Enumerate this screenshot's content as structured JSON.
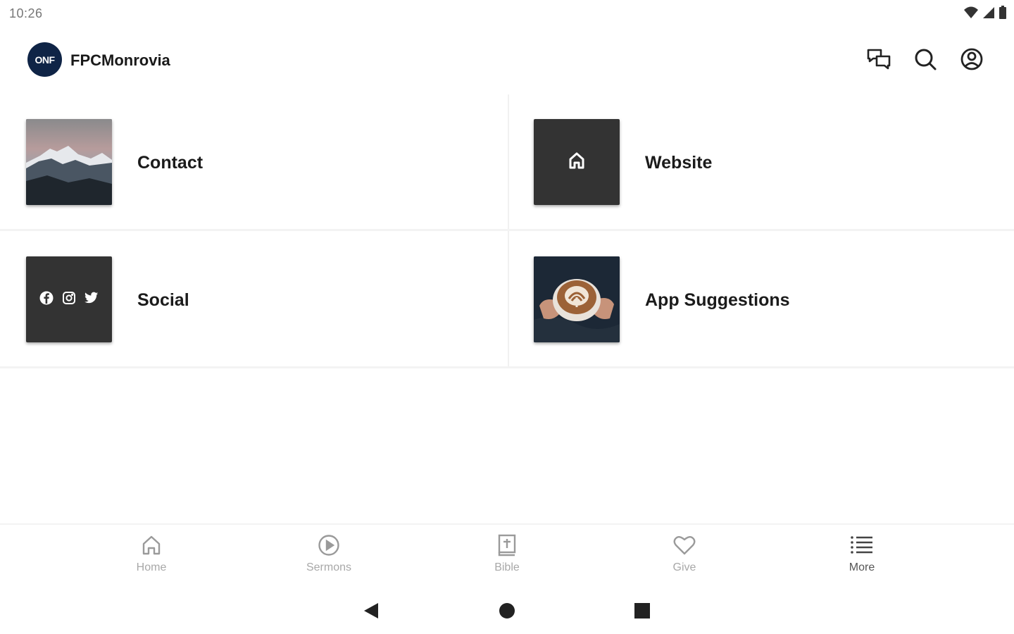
{
  "status_bar": {
    "time": "10:26",
    "icons": [
      "wifi-icon",
      "signal-icon",
      "battery-icon"
    ]
  },
  "app_bar": {
    "logo_text": "ONF",
    "title": "FPCMonrovia",
    "actions": [
      "chat-icon",
      "search-icon",
      "account-icon"
    ]
  },
  "tiles": [
    {
      "label": "Contact",
      "thumb": "mountain-photo"
    },
    {
      "label": "Website",
      "thumb": "home-icon"
    },
    {
      "label": "Social",
      "thumb": "social-icons"
    },
    {
      "label": "App Suggestions",
      "thumb": "coffee-photo"
    }
  ],
  "bottom_nav": [
    {
      "label": "Home",
      "icon": "home-icon"
    },
    {
      "label": "Sermons",
      "icon": "play-circle-icon"
    },
    {
      "label": "Bible",
      "icon": "bible-icon"
    },
    {
      "label": "Give",
      "icon": "heart-icon"
    },
    {
      "label": "More",
      "icon": "list-icon",
      "active": true
    }
  ],
  "colors": {
    "logo_bg": "#0f2446",
    "tile_dark": "#333333",
    "nav_label": "#a8a8a8"
  }
}
